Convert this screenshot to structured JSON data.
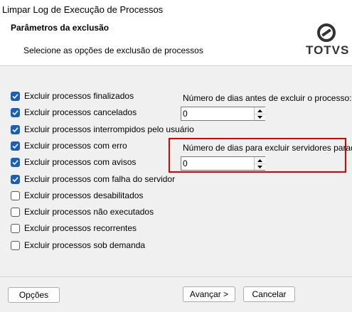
{
  "window": {
    "title": "Limpar Log de Execução de Processos"
  },
  "header": {
    "title": "Parâmetros da exclusão",
    "subtitle": "Selecione as opções de exclusão de processos",
    "logo_text": "TOTVS"
  },
  "options": [
    {
      "label": "Excluir processos finalizados",
      "checked": true
    },
    {
      "label": "Excluir processos cancelados",
      "checked": true
    },
    {
      "label": "Excluir processos interrompidos pelo usuário",
      "checked": true
    },
    {
      "label": "Excluir processos com erro",
      "checked": true
    },
    {
      "label": "Excluir processos com avisos",
      "checked": true
    },
    {
      "label": "Excluir processos com falha do servidor",
      "checked": true
    },
    {
      "label": "Excluir processos desabilitados",
      "checked": false
    },
    {
      "label": "Excluir processos não executados",
      "checked": false
    },
    {
      "label": "Excluir processos recorrentes",
      "checked": false
    },
    {
      "label": "Excluir processos sob demanda",
      "checked": false
    }
  ],
  "days_before_delete": {
    "label": "Número de dias antes de excluir o processo:",
    "value": "0"
  },
  "days_stopped_servers": {
    "label": "Número de dias para excluir servidores parados:",
    "value": "0"
  },
  "footer": {
    "options_label": "Opções",
    "next_label": "Avançar >",
    "cancel_label": "Cancelar"
  },
  "colors": {
    "accent": "#1a5fb4",
    "highlight": "#e00000"
  }
}
